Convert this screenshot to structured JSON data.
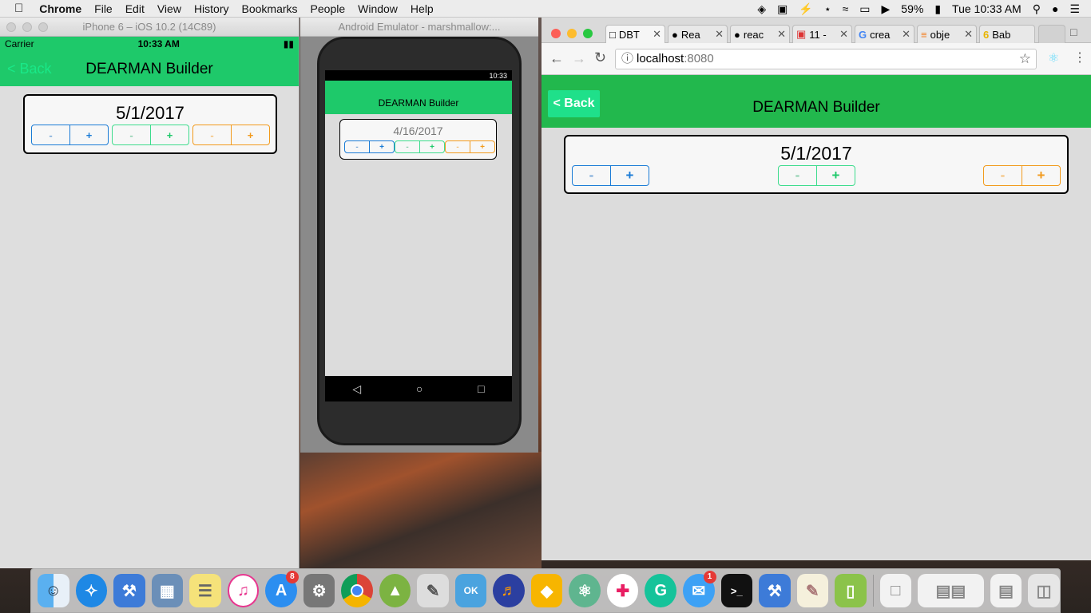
{
  "menubar": {
    "app": "Chrome",
    "items": [
      "File",
      "Edit",
      "View",
      "History",
      "Bookmarks",
      "People",
      "Window",
      "Help"
    ],
    "battery": "59%",
    "clock": "Tue 10:33 AM"
  },
  "ios": {
    "window_title": "iPhone 6 – iOS 10.2 (14C89)",
    "carrier": "Carrier",
    "time": "10:33 AM",
    "back": "< Back",
    "title": "DEARMAN Builder",
    "date": "5/1/2017",
    "minus": "-",
    "plus": "+"
  },
  "android": {
    "window_title": "Android Emulator - marshmallow:...",
    "time": "10:33",
    "title": "DEARMAN Builder",
    "date": "4/16/2017",
    "minus": "-",
    "plus": "+"
  },
  "chrome": {
    "tabs": [
      "DBT",
      "Rea",
      "reac",
      "11 -",
      "crea",
      "obje",
      "Bab"
    ],
    "url_host": "localhost",
    "url_port": ":8080",
    "back": "< Back",
    "title": "DEARMAN Builder",
    "date": "5/1/2017",
    "minus": "-",
    "plus": "+"
  },
  "dock": {
    "appstore_badge": "8",
    "messages_badge": "1"
  },
  "colors": {
    "header_green": "#1ec96a",
    "blue": "#1a7bd6",
    "green": "#3ddc8c",
    "orange": "#f29a1c"
  }
}
